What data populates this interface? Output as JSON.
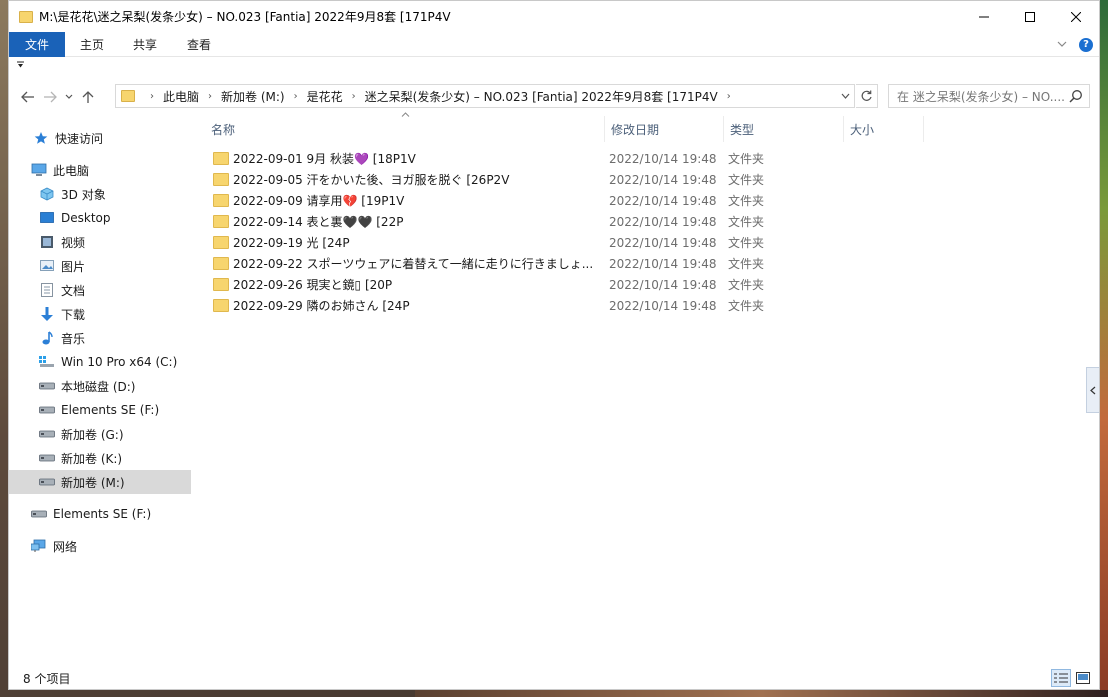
{
  "window": {
    "title": "M:\\是花花\\迷之呆梨(发条少女) – NO.023 [Fantia] 2022年9月8套 [171P4V",
    "minimize_glyph": "—",
    "maximize_glyph": "☐",
    "close_glyph": "✕"
  },
  "ribbon": {
    "tabs": [
      "文件",
      "主页",
      "共享",
      "查看"
    ],
    "help_glyph": "?"
  },
  "address": {
    "crumbs": [
      "此电脑",
      "新加卷 (M:)",
      "是花花",
      "迷之呆梨(发条少女) – NO.023 [Fantia] 2022年9月8套 [171P4V"
    ],
    "search_placeholder": "在 迷之呆梨(发条少女) – NO...."
  },
  "sidebar": {
    "items": [
      {
        "label": "快速访问",
        "icon": "star-icon"
      },
      {
        "label": "此电脑",
        "icon": "computer-icon"
      },
      {
        "label": "3D 对象",
        "icon": "cube-icon"
      },
      {
        "label": "Desktop",
        "icon": "desktop-icon"
      },
      {
        "label": "视频",
        "icon": "video-icon"
      },
      {
        "label": "图片",
        "icon": "picture-icon"
      },
      {
        "label": "文档",
        "icon": "document-icon"
      },
      {
        "label": "下载",
        "icon": "download-icon"
      },
      {
        "label": "音乐",
        "icon": "music-icon"
      },
      {
        "label": "Win 10 Pro x64 (C:)",
        "icon": "windows-drive-icon"
      },
      {
        "label": "本地磁盘 (D:)",
        "icon": "drive-icon"
      },
      {
        "label": "Elements SE (F:)",
        "icon": "drive-icon"
      },
      {
        "label": "新加卷 (G:)",
        "icon": "drive-icon"
      },
      {
        "label": "新加卷 (K:)",
        "icon": "drive-icon"
      },
      {
        "label": "新加卷 (M:)",
        "icon": "drive-icon"
      },
      {
        "label": "Elements SE (F:)",
        "icon": "drive-icon"
      },
      {
        "label": "网络",
        "icon": "network-icon"
      }
    ]
  },
  "columns": {
    "name": "名称",
    "date": "修改日期",
    "type": "类型",
    "size": "大小"
  },
  "files": [
    {
      "name": "2022-09-01 9月 秋装💜 [18P1V",
      "date": "2022/10/14 19:48",
      "type": "文件夹"
    },
    {
      "name": "2022-09-05 汗をかいた後、ヨガ服を脱ぐ [26P2V",
      "date": "2022/10/14 19:48",
      "type": "文件夹"
    },
    {
      "name": "2022-09-09 请享用💔 [19P1V",
      "date": "2022/10/14 19:48",
      "type": "文件夹"
    },
    {
      "name": "2022-09-14 表と裏🖤🖤 [22P",
      "date": "2022/10/14 19:48",
      "type": "文件夹"
    },
    {
      "name": "2022-09-19 光 [24P",
      "date": "2022/10/14 19:48",
      "type": "文件夹"
    },
    {
      "name": "2022-09-22 スポーツウェアに着替えて一緒に走りに行きましょ...",
      "date": "2022/10/14 19:48",
      "type": "文件夹"
    },
    {
      "name": "2022-09-26 現実と鏡▯ [20P",
      "date": "2022/10/14 19:48",
      "type": "文件夹"
    },
    {
      "name": "2022-09-29 隣のお姉さん [24P",
      "date": "2022/10/14 19:48",
      "type": "文件夹"
    }
  ],
  "status": {
    "count_text": "8 个项目"
  },
  "colors": {
    "accent": "#1a62b8",
    "folder": "#f7d56e",
    "selected": "#d9d9d9"
  }
}
